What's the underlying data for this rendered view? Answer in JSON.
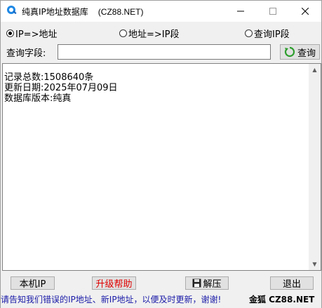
{
  "window": {
    "title": "纯真IP地址数据库",
    "title_suffix": "(CZ88.NET)"
  },
  "radios": [
    {
      "label": "IP=>地址",
      "checked": true
    },
    {
      "label": "地址=>IP段",
      "checked": false
    },
    {
      "label": "查询IP段",
      "checked": false
    }
  ],
  "query": {
    "label": "查询字段:",
    "value": "",
    "button_label": "查询"
  },
  "output": {
    "lines": "记录总数:1508640条\n更新日期:2025年07月09日\n数据库版本:纯真"
  },
  "buttons": {
    "local_ip": "本机IP",
    "upgrade_help": "升级帮助",
    "extract": "解压",
    "exit": "退出"
  },
  "status": {
    "text": "请告知我们错误的IP地址、新IP地址，以便及时更新，谢谢!",
    "right": "金狐 CZ88.NET"
  },
  "colors": {
    "help_text": "#e00000",
    "status_text": "#1a1aa8"
  },
  "icons": [
    "app-icon",
    "minimize-icon",
    "maximize-icon",
    "close-icon",
    "refresh-icon",
    "floppy-icon",
    "scroll-up-icon",
    "scroll-down-icon"
  ]
}
